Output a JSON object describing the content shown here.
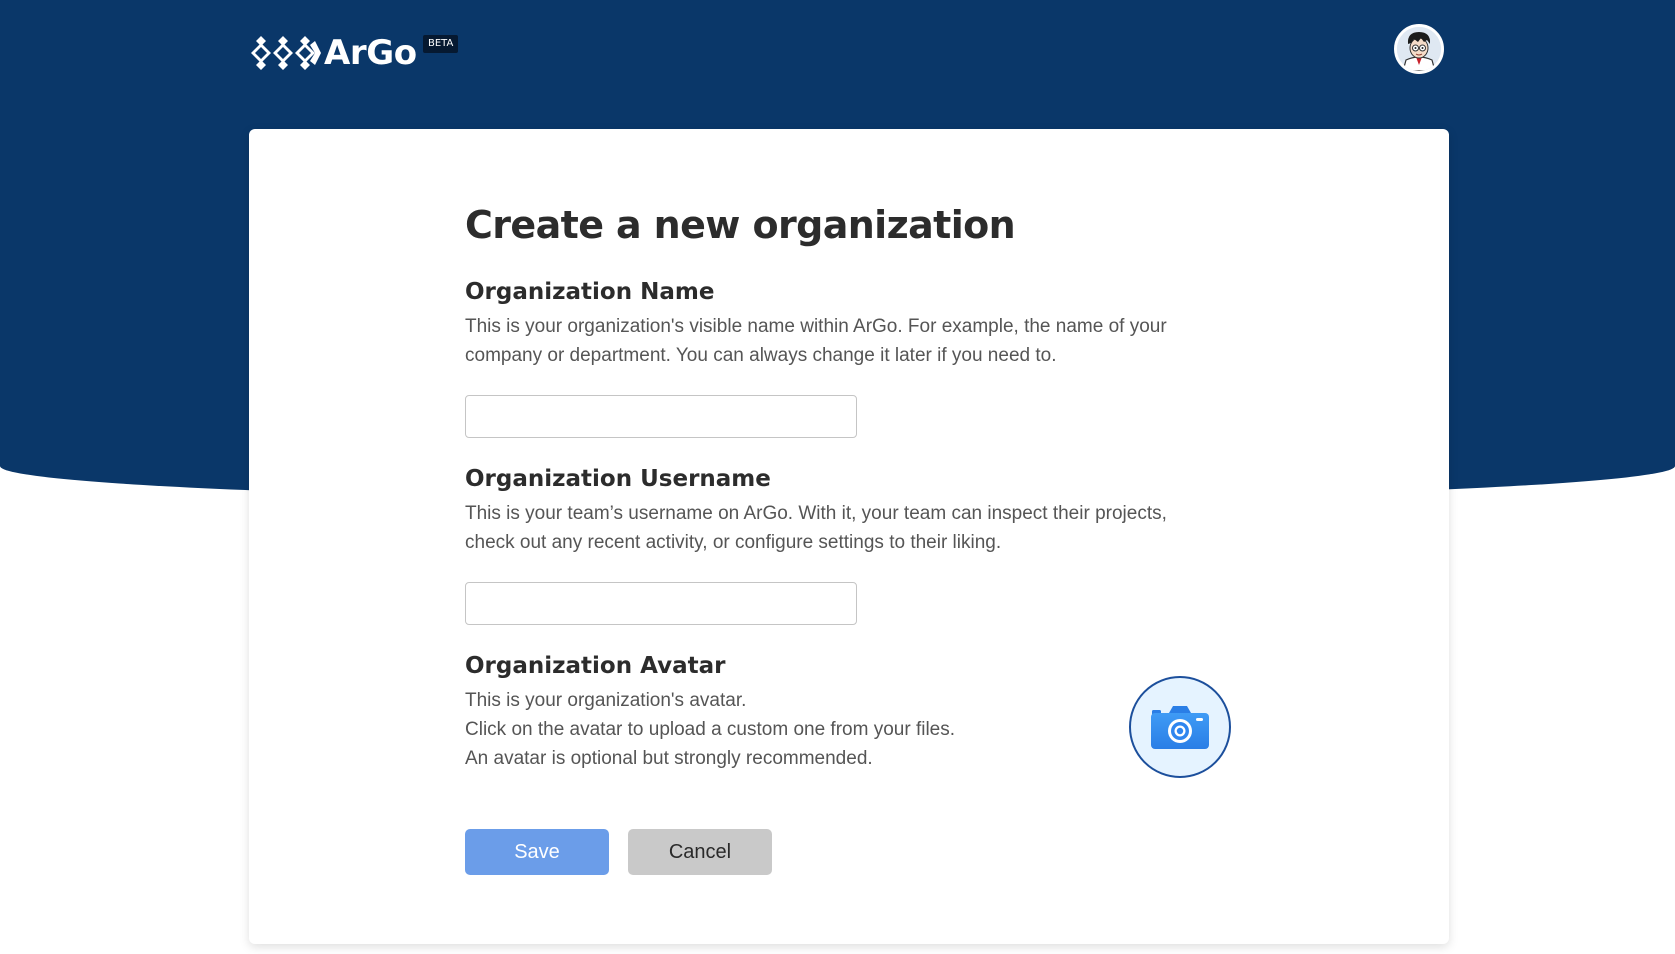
{
  "header": {
    "brand_name": "ArGo",
    "badge": "BETA",
    "logo_icon": "argo-diamonds-logo",
    "user_avatar_icon": "user-avatar-cartoon"
  },
  "form": {
    "title": "Create a new organization",
    "name": {
      "label": "Organization Name",
      "description_lines": [
        "This is your organization's visible name within ArGo. For example, the name of your",
        "company or department. You can always change it later if you need to."
      ],
      "value": "",
      "placeholder": ""
    },
    "username": {
      "label": "Organization Username",
      "description_lines": [
        "This is your team’s username on ArGo. With it, your team can inspect their projects,",
        "check out any recent activity, or configure settings to their liking."
      ],
      "value": "",
      "placeholder": ""
    },
    "avatar": {
      "label": "Organization Avatar",
      "description_lines": [
        "This is your organization's avatar.",
        "Click on the avatar to upload a custom one from your files.",
        "An avatar is optional but strongly recommended."
      ],
      "icon": "camera-icon"
    },
    "save_label": "Save",
    "cancel_label": "Cancel"
  },
  "colors": {
    "header_background": "#0a3769",
    "primary_button": "#6b9de9",
    "secondary_button": "#c9c9c9",
    "avatar_ring": "#1c4f9c",
    "camera_accent": "#2f86ef"
  }
}
